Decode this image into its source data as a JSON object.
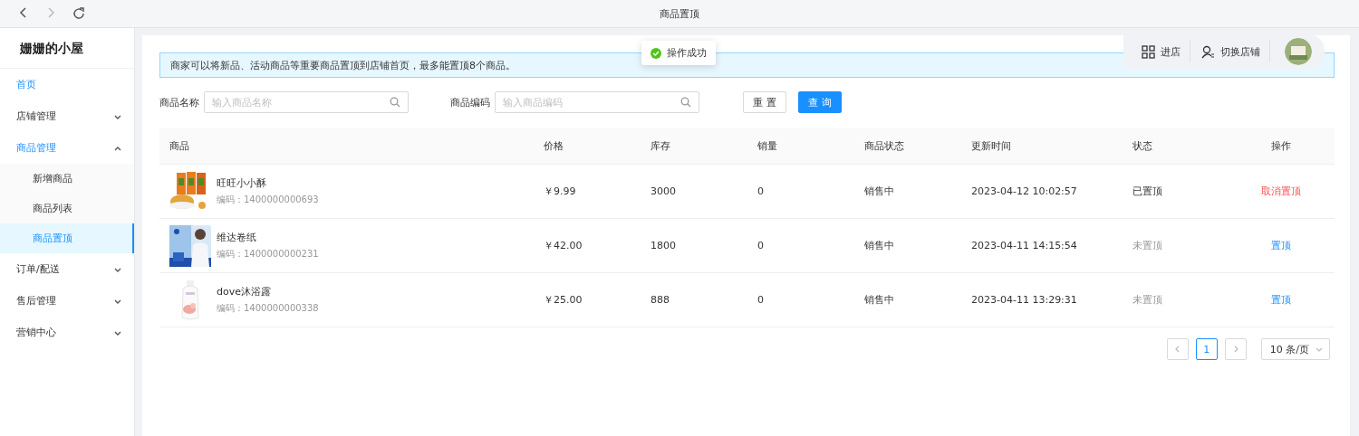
{
  "browser": {
    "title": "商品置顶"
  },
  "shop_name": "姗姗的小屋",
  "sidebar": {
    "items": [
      {
        "label": "首页",
        "selected": true,
        "expanded": false
      },
      {
        "label": "店铺管理",
        "selected": false,
        "expanded": false
      },
      {
        "label": "商品管理",
        "selected": true,
        "expanded": true,
        "children": [
          {
            "label": "新增商品",
            "selected": false
          },
          {
            "label": "商品列表",
            "selected": false
          },
          {
            "label": "商品置顶",
            "selected": true
          }
        ]
      },
      {
        "label": "订单/配送",
        "selected": false,
        "expanded": false
      },
      {
        "label": "售后管理",
        "selected": false,
        "expanded": false
      },
      {
        "label": "营销中心",
        "selected": false,
        "expanded": false
      }
    ]
  },
  "header_actions": [
    {
      "label": "进店",
      "kind": "grid"
    },
    {
      "label": "切换店铺",
      "kind": "user"
    }
  ],
  "toast": {
    "text": "操作成功"
  },
  "notice": "商家可以将新品、活动商品等重要商品置顶到店铺首页，最多能置顶8个商品。",
  "filters": [
    {
      "label": "商品名称",
      "placeholder": "输入商品名称"
    },
    {
      "label": "商品编码",
      "placeholder": "输入商品编码"
    }
  ],
  "buttons": [
    {
      "label": "重 置",
      "kind": "default"
    },
    {
      "label": "查 询",
      "kind": "primary"
    }
  ],
  "table": {
    "columns": [
      "商品",
      "价格",
      "库存",
      "销量",
      "商品状态",
      "更新时间",
      "状态",
      "操作"
    ],
    "rows": [
      {
        "name": "旺旺小小酥",
        "code": "编码：1400000000693",
        "price": "￥9.99",
        "stock": "3000",
        "sales": "0",
        "product_status": "销售中",
        "updated": "2023-04-12 10:02:57",
        "pinned": true,
        "status": "已置顶",
        "action": "取消置顶"
      },
      {
        "name": "维达卷纸",
        "code": "编码：1400000000231",
        "price": "￥42.00",
        "stock": "1800",
        "sales": "0",
        "product_status": "销售中",
        "updated": "2023-04-11 14:15:54",
        "pinned": false,
        "status": "未置顶",
        "action": "置顶"
      },
      {
        "name": "dove沐浴露",
        "code": "编码：1400000000338",
        "price": "￥25.00",
        "stock": "888",
        "sales": "0",
        "product_status": "销售中",
        "updated": "2023-04-11 13:29:31",
        "pinned": false,
        "status": "未置顶",
        "action": "置顶"
      }
    ]
  },
  "pagination": {
    "pages": [
      {
        "label": "1",
        "selected": true
      }
    ],
    "page_size": "10 条/页"
  }
}
